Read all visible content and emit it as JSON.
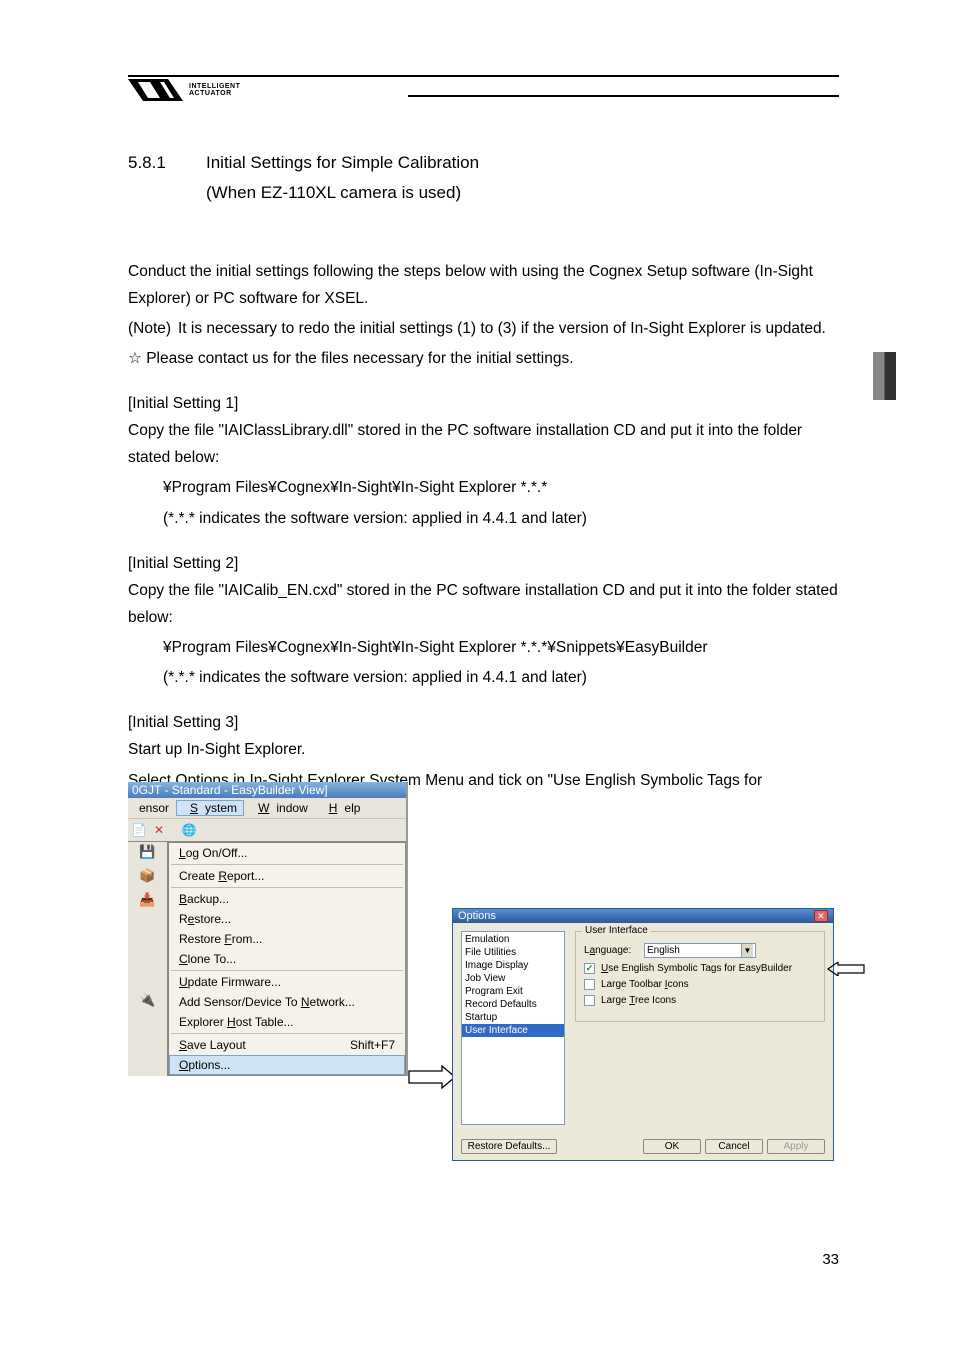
{
  "header": {
    "brand_line1": "INTELLIGENT",
    "brand_line2": "ACTUATOR"
  },
  "section": {
    "number": "5.8.1",
    "title_line1": "Initial Settings for Simple Calibration",
    "title_line2": "(When EZ-110XL camera is used)"
  },
  "body": {
    "p1": "Conduct the initial settings following the steps below with using the Cognex Setup software (In-Sight Explorer) or PC software for XSEL.",
    "note_label": "(Note)",
    "note_text": "It is necessary to redo the initial settings (1) to (3) if the version of In-Sight Explorer is updated.",
    "star": "☆ Please contact us for the files necessary for the initial settings.",
    "s1_h": "[Initial Setting 1]",
    "s1_p": "Copy the file \"IAIClassLibrary.dll\" stored in the PC software installation CD and put it into the folder stated below:",
    "s1_path": "¥Program Files¥Cognex¥In-Sight¥In-Sight Explorer *.*.*",
    "s1_note": "(*.*.* indicates the software version: applied in 4.4.1 and later)",
    "s2_h": "[Initial Setting 2]",
    "s2_p": "Copy the file \"IAICalib_EN.cxd\" stored in the PC software installation CD and put it into the folder stated below:",
    "s2_path": "¥Program Files¥Cognex¥In-Sight¥In-Sight Explorer *.*.*¥Snippets¥EasyBuilder",
    "s2_note": "(*.*.* indicates the software version: applied in 4.4.1 and later)",
    "s3_h": "[Initial Setting 3]",
    "s3_p1": "Start up In-Sight Explorer.",
    "s3_p2": "Select Options in In-Sight Explorer System Menu and tick on \"Use English Symbolic Tags for EasyBuilder\" in the User Interface items."
  },
  "shot1": {
    "title": "0GJT - Standard - EasyBuilder View]",
    "menubar": {
      "m0": "ensor",
      "m1": "System",
      "m2": "Window",
      "m3": "Help"
    },
    "menu": {
      "i0": "Log On/Off...",
      "i1": "Create Report...",
      "i2": "Backup...",
      "i3": "Restore...",
      "i4": "Restore From...",
      "i5": "Clone To...",
      "i6": "Update Firmware...",
      "i7": "Add Sensor/Device To Network...",
      "i8": "Explorer Host Table...",
      "i9": "Save Layout",
      "i9_accel": "Shift+F7",
      "i10": "Options..."
    }
  },
  "shot2": {
    "title": "Options",
    "list": {
      "i0": "Emulation",
      "i1": "File Utilities",
      "i2": "Image Display",
      "i3": "Job View",
      "i4": "Program Exit",
      "i5": "Record Defaults",
      "i6": "Startup",
      "i7": "User Interface"
    },
    "group_title": "User Interface",
    "lang_label": "Language:",
    "lang_value": "English",
    "chk1": "Use English Symbolic Tags for EasyBuilder",
    "chk2": "Large Toolbar Icons",
    "chk3": "Large Tree Icons",
    "btn_restore": "Restore Defaults...",
    "btn_ok": "OK",
    "btn_cancel": "Cancel",
    "btn_apply": "Apply"
  },
  "page_number": "33"
}
